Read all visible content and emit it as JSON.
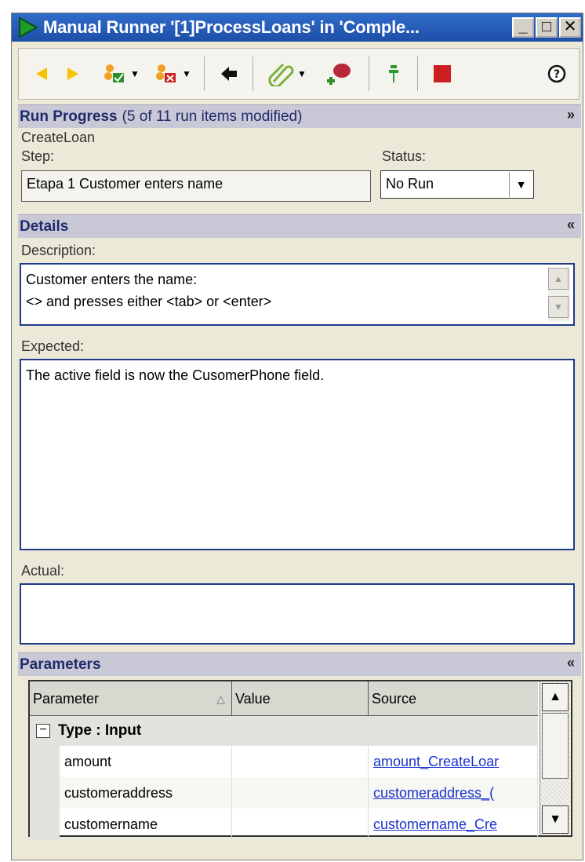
{
  "window": {
    "title": "Manual Runner '[1]ProcessLoans' in 'Comple...",
    "controls": {
      "minimize": "_",
      "maximize": "□",
      "close": "✕"
    }
  },
  "toolbar": {
    "buttons": [
      {
        "name": "previous",
        "icon": "arrow-left-yellow"
      },
      {
        "name": "next",
        "icon": "arrow-right-yellow"
      },
      {
        "name": "pass-selected",
        "icon": "pass-check",
        "dropdown": true
      },
      {
        "name": "fail-selected",
        "icon": "fail-x",
        "dropdown": true
      },
      {
        "name": "back",
        "icon": "arrow-left-black"
      },
      {
        "name": "attachments",
        "icon": "paperclip",
        "dropdown": true
      },
      {
        "name": "add-defect",
        "icon": "bug-plus"
      },
      {
        "name": "pin",
        "icon": "pin-green"
      },
      {
        "name": "stop",
        "icon": "stop-red"
      },
      {
        "name": "help",
        "icon": "help-circle"
      }
    ]
  },
  "run_progress": {
    "title": "Run Progress",
    "summary": "(5 of 11 run items modified)",
    "test_name": "CreateLoan",
    "step_label": "Step:",
    "step_value": "Etapa 1 Customer enters name",
    "status_label": "Status:",
    "status_value": "No Run"
  },
  "details": {
    "title": "Details",
    "description_label": "Description:",
    "description_line1": "Customer enters the name:",
    "description_line2": "<> and presses either <tab> or <enter>",
    "expected_label": "Expected:",
    "expected_value": "The active field is now the CusomerPhone field.",
    "actual_label": "Actual:",
    "actual_value": ""
  },
  "parameters": {
    "title": "Parameters",
    "columns": [
      "Parameter",
      "Value",
      "Source"
    ],
    "group_label": "Type : Input",
    "rows": [
      {
        "parameter": "amount",
        "value": "",
        "source": "amount_CreateLoar"
      },
      {
        "parameter": "customeraddress",
        "value": "",
        "source": "customeraddress_("
      },
      {
        "parameter": "customername",
        "value": "",
        "source": "customername_Cre"
      }
    ]
  },
  "colors": {
    "titlebar": "#2f6cc9",
    "section_header": "#c9c8d6",
    "link": "#1a33cc",
    "stop": "#cc1f1f"
  }
}
